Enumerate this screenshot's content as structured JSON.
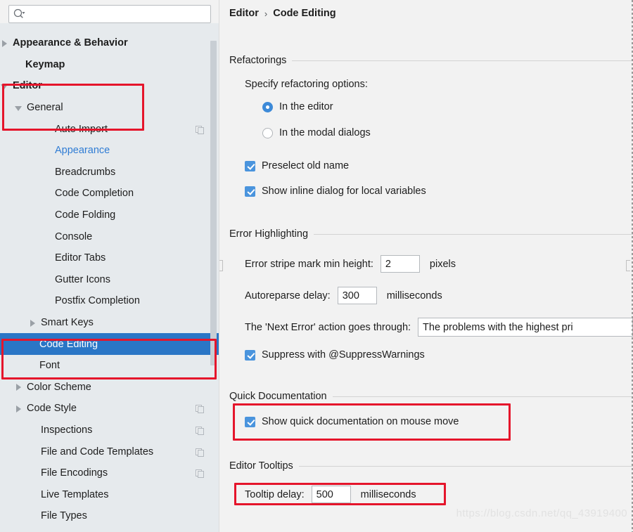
{
  "window": {
    "watermark": "https://blog.csdn.net/qq_43919400"
  },
  "search": {
    "value": "",
    "placeholder": "",
    "icon": "search-icon"
  },
  "sidebar": {
    "scrollbar": "vertical-scrollbar",
    "items": [
      {
        "label": "Appearance & Behavior",
        "arrow": "right",
        "indent": 18,
        "bold": true,
        "selected": false,
        "link": false,
        "badge": false
      },
      {
        "label": "Keymap",
        "arrow": "none",
        "indent": 36,
        "bold": true,
        "selected": false,
        "link": false,
        "badge": false
      },
      {
        "label": "Editor",
        "arrow": "down",
        "indent": 18,
        "bold": true,
        "selected": false,
        "link": false,
        "badge": false
      },
      {
        "label": "General",
        "arrow": "down",
        "indent": 38,
        "bold": false,
        "selected": false,
        "link": false,
        "badge": false
      },
      {
        "label": "Auto Import",
        "arrow": "none",
        "indent": 78,
        "bold": false,
        "selected": false,
        "link": false,
        "badge": true
      },
      {
        "label": "Appearance",
        "arrow": "none",
        "indent": 78,
        "bold": false,
        "selected": false,
        "link": true,
        "badge": false
      },
      {
        "label": "Breadcrumbs",
        "arrow": "none",
        "indent": 78,
        "bold": false,
        "selected": false,
        "link": false,
        "badge": false
      },
      {
        "label": "Code Completion",
        "arrow": "none",
        "indent": 78,
        "bold": false,
        "selected": false,
        "link": false,
        "badge": false
      },
      {
        "label": "Code Folding",
        "arrow": "none",
        "indent": 78,
        "bold": false,
        "selected": false,
        "link": false,
        "badge": false
      },
      {
        "label": "Console",
        "arrow": "none",
        "indent": 78,
        "bold": false,
        "selected": false,
        "link": false,
        "badge": false
      },
      {
        "label": "Editor Tabs",
        "arrow": "none",
        "indent": 78,
        "bold": false,
        "selected": false,
        "link": false,
        "badge": false
      },
      {
        "label": "Gutter Icons",
        "arrow": "none",
        "indent": 78,
        "bold": false,
        "selected": false,
        "link": false,
        "badge": false
      },
      {
        "label": "Postfix Completion",
        "arrow": "none",
        "indent": 78,
        "bold": false,
        "selected": false,
        "link": false,
        "badge": false
      },
      {
        "label": "Smart Keys",
        "arrow": "right",
        "indent": 58,
        "bold": false,
        "selected": false,
        "link": false,
        "badge": false
      },
      {
        "label": "Code Editing",
        "arrow": "none",
        "indent": 56,
        "bold": false,
        "selected": true,
        "link": false,
        "badge": false
      },
      {
        "label": "Font",
        "arrow": "none",
        "indent": 56,
        "bold": false,
        "selected": false,
        "link": false,
        "badge": false
      },
      {
        "label": "Color Scheme",
        "arrow": "right",
        "indent": 38,
        "bold": false,
        "selected": false,
        "link": false,
        "badge": false
      },
      {
        "label": "Code Style",
        "arrow": "right",
        "indent": 38,
        "bold": false,
        "selected": false,
        "link": false,
        "badge": true
      },
      {
        "label": "Inspections",
        "arrow": "none",
        "indent": 58,
        "bold": false,
        "selected": false,
        "link": false,
        "badge": true
      },
      {
        "label": "File and Code Templates",
        "arrow": "none",
        "indent": 58,
        "bold": false,
        "selected": false,
        "link": false,
        "badge": true
      },
      {
        "label": "File Encodings",
        "arrow": "none",
        "indent": 58,
        "bold": false,
        "selected": false,
        "link": false,
        "badge": true
      },
      {
        "label": "Live Templates",
        "arrow": "none",
        "indent": 58,
        "bold": false,
        "selected": false,
        "link": false,
        "badge": false
      },
      {
        "label": "File Types",
        "arrow": "none",
        "indent": 58,
        "bold": false,
        "selected": false,
        "link": false,
        "badge": false
      }
    ]
  },
  "breadcrumb": {
    "parent": "Editor",
    "separator": "›",
    "current": "Code Editing"
  },
  "refactorings": {
    "title": "Refactorings",
    "specify_label": "Specify refactoring options:",
    "radio_editor": "In the editor",
    "radio_modal": "In the modal dialogs",
    "radio_selected": "In the editor",
    "check_preselect": "Preselect old name",
    "check_preselect_on": true,
    "check_inline": "Show inline dialog for local variables",
    "check_inline_on": true
  },
  "error_highlighting": {
    "title": "Error Highlighting",
    "stripe_label": "Error stripe mark min height:",
    "stripe_value": "2",
    "stripe_units": "pixels",
    "autoreparse_label": "Autoreparse delay:",
    "autoreparse_value": "300",
    "autoreparse_units": "milliseconds",
    "next_error_label": "The 'Next Error' action goes through:",
    "next_error_value": "The problems with the highest pri",
    "suppress_label": "Suppress with @SuppressWarnings",
    "suppress_on": true
  },
  "quick_documentation": {
    "title": "Quick Documentation",
    "check_label": "Show quick documentation on mouse move",
    "check_on": true
  },
  "editor_tooltips": {
    "title": "Editor Tooltips",
    "delay_label": "Tooltip delay:",
    "delay_value": "500",
    "delay_units": "milliseconds"
  },
  "colors": {
    "accent_blue": "#2a76c6",
    "check_blue": "#4a94dd",
    "link_blue": "#2f7cd4",
    "annotation_red": "#e5152b",
    "sidebar_bg": "#e6eaed",
    "panel_bg": "#f2f2f2"
  }
}
